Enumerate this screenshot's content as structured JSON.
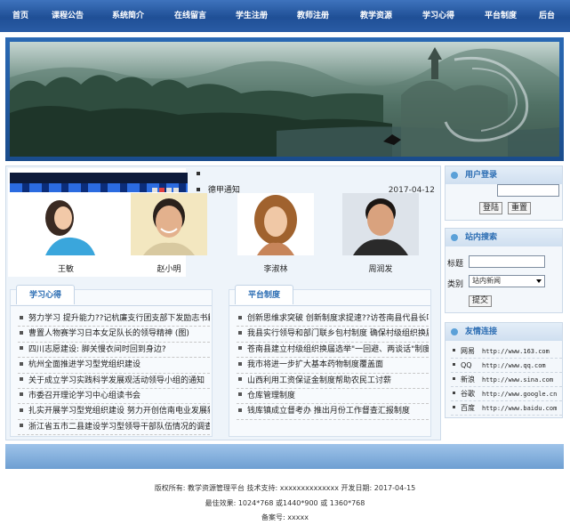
{
  "nav": [
    "首页",
    "课程公告",
    "系统简介",
    "在线留言",
    "学生注册",
    "教师注册",
    "教学资源",
    "学习心得",
    "平台制度",
    "后台"
  ],
  "news_top": [
    {
      "title": "",
      "date": ""
    },
    {
      "title": "德甲通知",
      "date": "2017-04-12"
    }
  ],
  "people": [
    "王敏",
    "赵小明",
    "李淑林",
    "周润发"
  ],
  "study": {
    "tab": "学习心得",
    "items": [
      "努力学习 提升能力??记杭廉支行团支部下发励志书籍",
      "曹置人物赛学习日本女足队长的领导精神 (图)",
      "四川志愿建设: 脚关慢衣间时回到身边?",
      "杭州全面推进学习型党组织建设",
      "关于成立学习实践科学发展观活动领导小组的通知",
      "市委召开理论学习中心组读书会",
      "扎实开展学习型党组织建设 努力开创信南电业发展新�",
      "浙江省五市二县建设学习型领导干部队伍情况的调查"
    ]
  },
  "policy": {
    "tab": "平台制度",
    "items": [
      "创新思维求突破 创新制度求提速??访苍南县代县长叶�",
      "我县实行领导和部门联乡包村制度 确保村级组织换届�",
      "苍南县建立村级组织换届选举\"一回避、两谈话\"制度",
      "我市将进一步扩大基本药物制度覆盖面",
      "山西利用工资保证金制度帮助农民工讨薪",
      "仓库管理制度",
      "钱库镇成立督考办 推出月份工作督查汇报制度"
    ]
  },
  "login": {
    "title": "用户登录",
    "login_label": "登陆",
    "reset_label": "重置"
  },
  "search": {
    "title": "站内搜索",
    "keyword_label": "标题",
    "keyword_value": "",
    "category_label": "类别",
    "category_value": "站内新闻",
    "submit_label": "提交"
  },
  "links": {
    "title": "友情连接",
    "items": [
      {
        "name": "网易",
        "url": "http://www.163.com"
      },
      {
        "name": "QQ",
        "url": "http://www.qq.com"
      },
      {
        "name": "新浪",
        "url": "http://www.sina.com"
      },
      {
        "name": "谷歌",
        "url": "http://www.google.cn"
      },
      {
        "name": "百度",
        "url": "http://www.baidu.com"
      }
    ]
  },
  "footer": {
    "line1": "版权所有: 教学资源管理平台 技术支持: xxxxxxxxxxxxxx 开发日期: 2017-04-15",
    "line2": "最佳效果: 1024*768 或1440*900 或 1360*768",
    "line3": "备案号: xxxxx"
  }
}
